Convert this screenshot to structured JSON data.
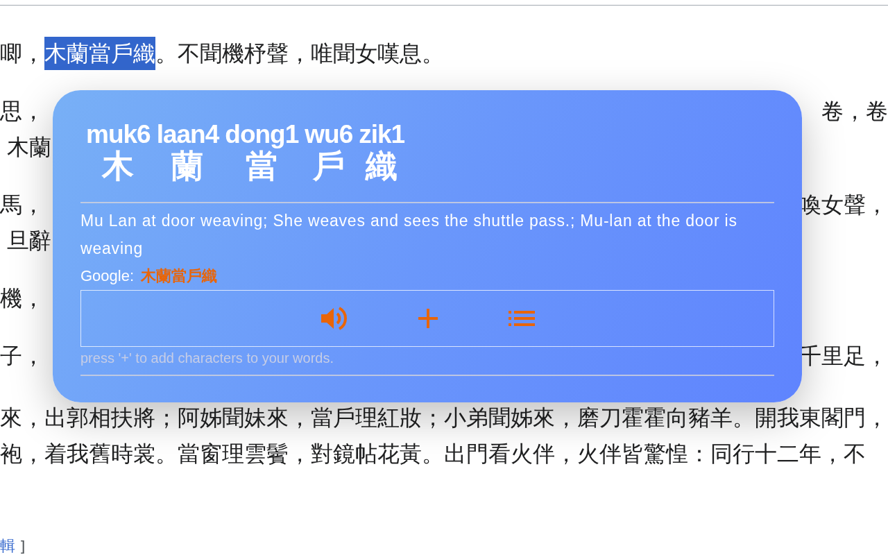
{
  "article": {
    "paragraphs": [
      {
        "lines": [
          {
            "left": [
              {
                "text": "唧，",
                "selected": false
              },
              {
                "text": "木蘭當戶織",
                "selected": true
              },
              {
                "text": "。不聞機杼聲，唯聞女嘆息。",
                "selected": false
              }
            ]
          }
        ]
      },
      {
        "lines": [
          {
            "left": [
              {
                "text": "思，",
                "selected": false
              }
            ],
            "right": "卷，卷"
          },
          {
            "left": [
              {
                "text": "木蘭",
                "selected": false
              }
            ]
          }
        ]
      },
      {
        "lines": [
          {
            "left": [
              {
                "text": "馬，",
                "selected": false
              }
            ],
            "right": "喚女聲，"
          },
          {
            "left": [
              {
                "text": "旦辭",
                "selected": false
              }
            ]
          }
        ]
      },
      {
        "lines": [
          {
            "left": [
              {
                "text": "機，",
                "selected": false
              }
            ]
          }
        ]
      },
      {
        "lines": [
          {
            "left": [
              {
                "text": "子，",
                "selected": false
              }
            ],
            "right": "千里足，"
          }
        ]
      },
      {
        "lines": [
          {
            "left": [
              {
                "text": "來，出郭相扶將；阿姊聞妹來，當戶理紅妝；小弟聞姊來，磨刀霍霍向豬羊。開我東閣門，",
                "selected": false
              }
            ]
          },
          {
            "left": [
              {
                "text": "袍，着我舊時裳。當窗理雲鬢，對鏡帖花黃。出門看火伴，火伴皆驚惶：同行十二年，不",
                "selected": false
              }
            ]
          }
        ]
      }
    ],
    "footer": {
      "link": "輯",
      "bracket": "]"
    }
  },
  "popup": {
    "syllables": [
      {
        "jyutping": "muk6",
        "char": "木"
      },
      {
        "jyutping": "laan4",
        "char": "蘭"
      },
      {
        "jyutping": "dong1",
        "char": "當"
      },
      {
        "jyutping": "wu6",
        "char": "戶"
      },
      {
        "jyutping": "zik1",
        "char": "織"
      }
    ],
    "definition": "Mu Lan at door weaving; She weaves and sees the shuttle pass.; Mu-lan at the door is weaving",
    "google_label": "Google:",
    "google_link": "木蘭當戶織",
    "actions": [
      {
        "kind": "speak"
      },
      {
        "kind": "add"
      },
      {
        "kind": "list"
      }
    ],
    "hint": "press '+' to add characters to your words."
  }
}
